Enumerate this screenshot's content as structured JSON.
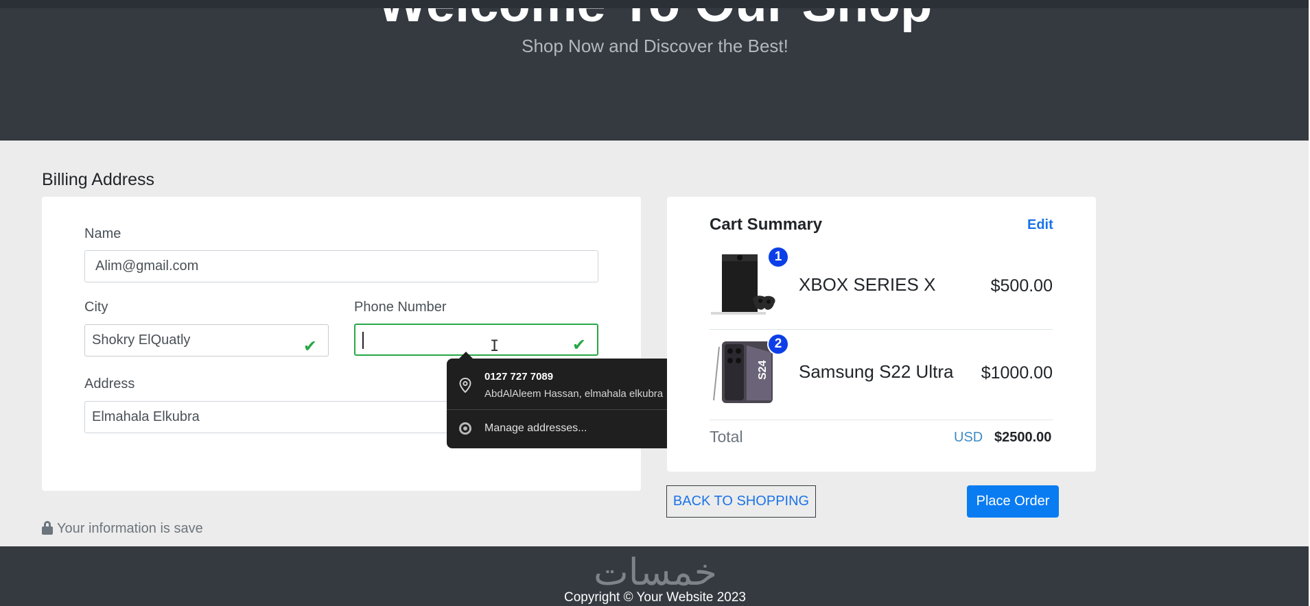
{
  "hero": {
    "title": "Welcome To Our Shop",
    "subtitle": "Shop Now and Discover the Best!"
  },
  "billing": {
    "section_title": "Billing Address",
    "name_label": "Name",
    "name_value": "Alim@gmail.com",
    "city_label": "City",
    "city_value": "Shokry ElQuatly",
    "phone_label": "Phone Number",
    "phone_value": "",
    "address_label": "Address",
    "address_value": "Elmahala Elkubra",
    "secure_note": "Your information is save"
  },
  "autofill_popup": {
    "phone": "0127 727 7089",
    "address": "AbdAlAleem Hassan, elmahala elkubra",
    "manage_label": "Manage addresses..."
  },
  "cart": {
    "title": "Cart Summary",
    "edit_label": "Edit",
    "items": [
      {
        "badge": "1",
        "name": "XBOX SERIES X",
        "price": "$500.00",
        "icon": "xbox-console-image"
      },
      {
        "badge": "2",
        "name": "Samsung S22 Ultra",
        "price": "$1000.00",
        "icon": "samsung-phone-image"
      }
    ],
    "total_label": "Total",
    "currency": "USD",
    "total_value": "$2500.00"
  },
  "actions": {
    "back_label": "BACK TO SHOPPING",
    "place_order_label": "Place Order"
  },
  "footer": {
    "copyright": "Copyright © Your Website 2023",
    "watermark": "خمسات"
  },
  "colors": {
    "hero_bg": "#343a40",
    "accent_blue": "#0a7cf2",
    "valid_green": "#28a745",
    "badge_blue": "#0d3fe8"
  }
}
